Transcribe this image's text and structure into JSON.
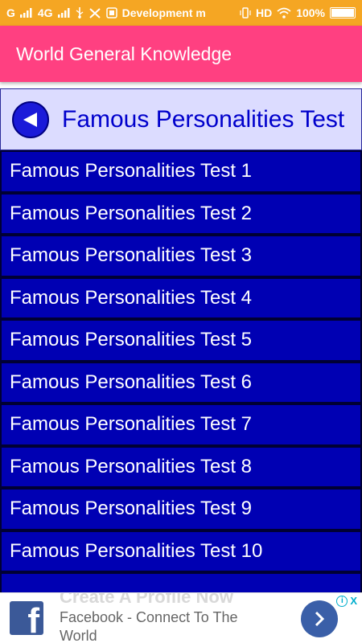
{
  "status_bar": {
    "carrier_left": "G",
    "network": "4G",
    "notification": "Development m",
    "hd": "HD",
    "battery": "100%"
  },
  "app_bar": {
    "title": "World General Knowledge"
  },
  "header": {
    "title": "Famous Personalities Test",
    "back_icon": "back-arrow-icon"
  },
  "list": {
    "items": [
      "Famous Personalities Test 1",
      "Famous Personalities Test 2",
      "Famous Personalities Test 3",
      "Famous Personalities Test 4",
      "Famous Personalities Test 5",
      "Famous Personalities Test 6",
      "Famous Personalities Test 7",
      "Famous Personalities Test 8",
      "Famous Personalities Test 9",
      "Famous Personalities Test 10"
    ]
  },
  "ad": {
    "ghost_text": "Create A Profile Now",
    "text": "Facebook - Connect To The World",
    "logo": "f",
    "info": "i",
    "close": "X"
  },
  "colors": {
    "status_bar": "#f5a623",
    "app_bar": "#ff4081",
    "header_bg": "#dcdcff",
    "header_text": "#0000cc",
    "list_item_bg": "#0000b3",
    "facebook_blue": "#3b5998"
  }
}
